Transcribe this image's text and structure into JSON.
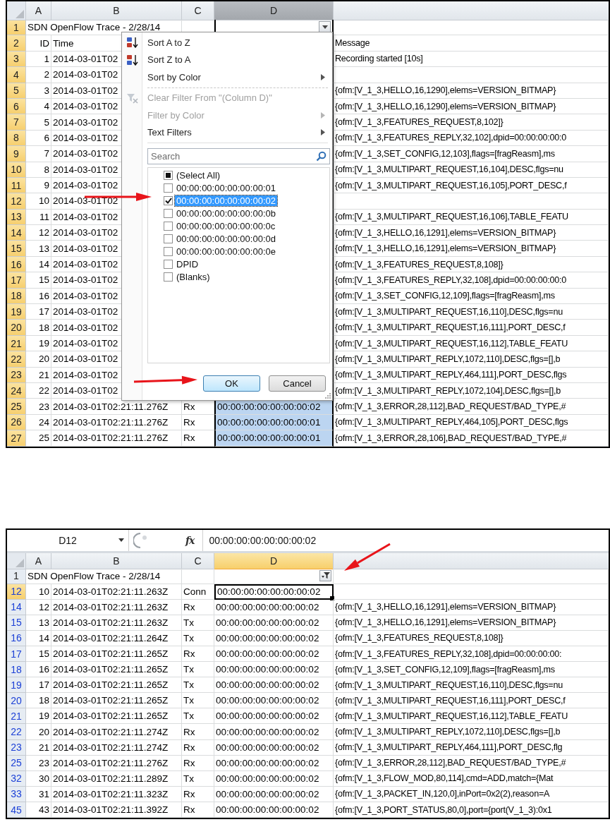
{
  "top_sheet": {
    "columns": [
      {
        "label": "A",
        "selected": false,
        "active": false
      },
      {
        "label": "B",
        "selected": false,
        "active": false
      },
      {
        "label": "C",
        "selected": false,
        "active": false
      },
      {
        "label": "D",
        "selected": true,
        "active": false
      }
    ],
    "rows": [
      {
        "header": "1",
        "active": true,
        "filtered": false,
        "title": "SDN OpenFlow Trace - 2/28/14",
        "filter_applied": false
      },
      {
        "header": "2",
        "active": true,
        "filtered": false,
        "cells": {
          "a": "ID",
          "b": "Time",
          "e": "Message"
        }
      },
      {
        "header": "3",
        "active": true,
        "filtered": false,
        "cells": {
          "a": "1",
          "b": "2014-03-01T02",
          "e": "Recording started [10s]"
        }
      },
      {
        "header": "4",
        "active": true,
        "filtered": false,
        "cells": {
          "a": "2",
          "b": "2014-03-01T02"
        }
      },
      {
        "header": "5",
        "active": true,
        "filtered": false,
        "cells": {
          "a": "3",
          "b": "2014-03-01T02",
          "e": "{ofm:[V_1_3,HELLO,16,1290],elems=VERSION_BITMAP}"
        }
      },
      {
        "header": "6",
        "active": true,
        "filtered": false,
        "cells": {
          "a": "4",
          "b": "2014-03-01T02",
          "e": "{ofm:[V_1_3,HELLO,16,1290],elems=VERSION_BITMAP}"
        }
      },
      {
        "header": "7",
        "active": true,
        "filtered": false,
        "cells": {
          "a": "5",
          "b": "2014-03-01T02",
          "e": "{ofm:[V_1_3,FEATURES_REQUEST,8,102]}"
        }
      },
      {
        "header": "8",
        "active": true,
        "filtered": false,
        "cells": {
          "a": "6",
          "b": "2014-03-01T02",
          "e": "{ofm:[V_1_3,FEATURES_REPLY,32,102],dpid=00:00:00:00:0"
        }
      },
      {
        "header": "9",
        "active": true,
        "filtered": false,
        "cells": {
          "a": "7",
          "b": "2014-03-01T02",
          "e": "{ofm:[V_1_3,SET_CONFIG,12,103],flags=[fragReasm],ms"
        }
      },
      {
        "header": "10",
        "active": true,
        "filtered": false,
        "cells": {
          "a": "8",
          "b": "2014-03-01T02",
          "e": "{ofm:[V_1_3,MULTIPART_REQUEST,16,104],DESC,flgs=nu"
        }
      },
      {
        "header": "11",
        "active": true,
        "filtered": false,
        "cells": {
          "a": "9",
          "b": "2014-03-01T02",
          "e": "{ofm:[V_1_3,MULTIPART_REQUEST,16,105],PORT_DESC,f"
        }
      },
      {
        "header": "12",
        "active": true,
        "filtered": false,
        "cells": {
          "a": "10",
          "b": "2014-03-01T02"
        }
      },
      {
        "header": "13",
        "active": true,
        "filtered": false,
        "cells": {
          "a": "11",
          "b": "2014-03-01T02",
          "e": "{ofm:[V_1_3,MULTIPART_REQUEST,16,106],TABLE_FEATU"
        }
      },
      {
        "header": "14",
        "active": true,
        "filtered": false,
        "cells": {
          "a": "12",
          "b": "2014-03-01T02",
          "e": "{ofm:[V_1_3,HELLO,16,1291],elems=VERSION_BITMAP}"
        }
      },
      {
        "header": "15",
        "active": true,
        "filtered": false,
        "cells": {
          "a": "13",
          "b": "2014-03-01T02",
          "e": "{ofm:[V_1_3,HELLO,16,1291],elems=VERSION_BITMAP}"
        }
      },
      {
        "header": "16",
        "active": true,
        "filtered": false,
        "cells": {
          "a": "14",
          "b": "2014-03-01T02",
          "e": "{ofm:[V_1_3,FEATURES_REQUEST,8,108]}"
        }
      },
      {
        "header": "17",
        "active": true,
        "filtered": false,
        "cells": {
          "a": "15",
          "b": "2014-03-01T02",
          "e": "{ofm:[V_1_3,FEATURES_REPLY,32,108],dpid=00:00:00:00:0"
        }
      },
      {
        "header": "18",
        "active": true,
        "filtered": false,
        "cells": {
          "a": "16",
          "b": "2014-03-01T02",
          "e": "{ofm:[V_1_3,SET_CONFIG,12,109],flags=[fragReasm],ms"
        }
      },
      {
        "header": "19",
        "active": true,
        "filtered": false,
        "cells": {
          "a": "17",
          "b": "2014-03-01T02",
          "e": "{ofm:[V_1_3,MULTIPART_REQUEST,16,110],DESC,flgs=nu"
        }
      },
      {
        "header": "20",
        "active": true,
        "filtered": false,
        "cells": {
          "a": "18",
          "b": "2014-03-01T02",
          "e": "{ofm:[V_1_3,MULTIPART_REQUEST,16,111],PORT_DESC,f"
        }
      },
      {
        "header": "21",
        "active": true,
        "filtered": false,
        "cells": {
          "a": "19",
          "b": "2014-03-01T02",
          "e": "{ofm:[V_1_3,MULTIPART_REQUEST,16,112],TABLE_FEATU"
        }
      },
      {
        "header": "22",
        "active": true,
        "filtered": false,
        "cells": {
          "a": "20",
          "b": "2014-03-01T02",
          "e": "{ofm:[V_1_3,MULTIPART_REPLY,1072,110],DESC,flgs=[],b"
        }
      },
      {
        "header": "23",
        "active": true,
        "filtered": false,
        "cells": {
          "a": "21",
          "b": "2014-03-01T02",
          "e": "{ofm:[V_1_3,MULTIPART_REPLY,464,111],PORT_DESC,flgs"
        }
      },
      {
        "header": "24",
        "active": true,
        "filtered": false,
        "cells": {
          "a": "22",
          "b": "2014-03-01T02",
          "e": "{ofm:[V_1_3,MULTIPART_REPLY,1072,104],DESC,flgs=[],b"
        }
      },
      {
        "header": "25",
        "active": true,
        "filtered": false,
        "d_selected": true,
        "cells": {
          "a": "23",
          "b": "2014-03-01T02:21:11.276Z",
          "c": "Rx",
          "d": "00:00:00:00:00:00:00:02",
          "e": "{ofm:[V_1_3,ERROR,28,112],BAD_REQUEST/BAD_TYPE,#"
        }
      },
      {
        "header": "26",
        "active": true,
        "filtered": false,
        "d_selected": true,
        "cells": {
          "a": "24",
          "b": "2014-03-01T02:21:11.276Z",
          "c": "Rx",
          "d": "00:00:00:00:00:00:00:01",
          "e": "{ofm:[V_1_3,MULTIPART_REPLY,464,105],PORT_DESC,flgs"
        }
      },
      {
        "header": "27",
        "active": true,
        "filtered": false,
        "d_selected": true,
        "cells": {
          "a": "25",
          "b": "2014-03-01T02:21:11.276Z",
          "c": "Rx",
          "d": "00:00:00:00:00:00:00:01",
          "e": "{ofm:[V_1_3,ERROR,28,106],BAD_REQUEST/BAD_TYPE,#"
        }
      }
    ],
    "filter_menu": {
      "items": [
        {
          "label": "Sort A to Z",
          "kind": "sort_ascending",
          "disabled": false,
          "submenu": false
        },
        {
          "label": "Sort Z to A",
          "kind": "sort_descending",
          "disabled": false,
          "submenu": false
        },
        {
          "label": "Sort by Color",
          "kind": "plain",
          "disabled": false,
          "submenu": true
        },
        {
          "kind": "separator"
        },
        {
          "label": "Clear Filter From \"(Column D)\"",
          "kind": "clear_filter",
          "disabled": true,
          "submenu": false
        },
        {
          "label": "Filter by Color",
          "kind": "plain",
          "disabled": true,
          "submenu": true
        },
        {
          "label": "Text Filters",
          "kind": "plain",
          "disabled": false,
          "submenu": true
        }
      ],
      "search": {
        "placeholder": "Search"
      },
      "values": [
        {
          "label": "(Select All)",
          "checked": false,
          "mixed": true,
          "selected": false
        },
        {
          "label": "00:00:00:00:00:00:00:01",
          "checked": false,
          "mixed": false,
          "selected": false
        },
        {
          "label": "00:00:00:00:00:00:00:02",
          "checked": true,
          "mixed": false,
          "selected": true
        },
        {
          "label": "00:00:00:00:00:00:00:0b",
          "checked": false,
          "mixed": false,
          "selected": false
        },
        {
          "label": "00:00:00:00:00:00:00:0c",
          "checked": false,
          "mixed": false,
          "selected": false
        },
        {
          "label": "00:00:00:00:00:00:00:0d",
          "checked": false,
          "mixed": false,
          "selected": false
        },
        {
          "label": "00:00:00:00:00:00:00:0e",
          "checked": false,
          "mixed": false,
          "selected": false
        },
        {
          "label": "DPID",
          "checked": false,
          "mixed": false,
          "selected": false
        },
        {
          "label": "(Blanks)",
          "checked": false,
          "mixed": false,
          "selected": false
        }
      ],
      "buttons": [
        {
          "label": "OK",
          "default": true
        },
        {
          "label": "Cancel",
          "default": false
        }
      ]
    }
  },
  "filtered_sheet": {
    "formula_bar": {
      "name_box": "D12",
      "function_label": "fx",
      "formula": "00:00:00:00:00:00:00:02"
    },
    "columns": [
      {
        "label": "A",
        "selected": false,
        "active": false
      },
      {
        "label": "B",
        "selected": false,
        "active": false
      },
      {
        "label": "C",
        "selected": false,
        "active": false
      },
      {
        "label": "D",
        "selected": false,
        "active": true
      }
    ],
    "rows": [
      {
        "header": "1",
        "active": false,
        "filtered": false,
        "title": "SDN OpenFlow Trace - 2/28/14",
        "filter_applied": true
      },
      {
        "header": "12",
        "active": true,
        "filtered": true,
        "d_active": true,
        "cells": {
          "a": "10",
          "b": "2014-03-01T02:21:11.263Z",
          "c": "Conn",
          "d": "00:00:00:00:00:00:00:02"
        }
      },
      {
        "header": "14",
        "active": false,
        "filtered": true,
        "d_active": false,
        "cells": {
          "a": "12",
          "b": "2014-03-01T02:21:11.263Z",
          "c": "Rx",
          "d": "00:00:00:00:00:00:00:02",
          "e": "{ofm:[V_1_3,HELLO,16,1291],elems=VERSION_BITMAP}"
        }
      },
      {
        "header": "15",
        "active": false,
        "filtered": true,
        "d_active": false,
        "cells": {
          "a": "13",
          "b": "2014-03-01T02:21:11.263Z",
          "c": "Tx",
          "d": "00:00:00:00:00:00:00:02",
          "e": "{ofm:[V_1_3,HELLO,16,1291],elems=VERSION_BITMAP}"
        }
      },
      {
        "header": "16",
        "active": false,
        "filtered": true,
        "d_active": false,
        "cells": {
          "a": "14",
          "b": "2014-03-01T02:21:11.264Z",
          "c": "Tx",
          "d": "00:00:00:00:00:00:00:02",
          "e": "{ofm:[V_1_3,FEATURES_REQUEST,8,108]}"
        }
      },
      {
        "header": "17",
        "active": false,
        "filtered": true,
        "d_active": false,
        "cells": {
          "a": "15",
          "b": "2014-03-01T02:21:11.265Z",
          "c": "Rx",
          "d": "00:00:00:00:00:00:00:02",
          "e": "{ofm:[V_1_3,FEATURES_REPLY,32,108],dpid=00:00:00:00:"
        }
      },
      {
        "header": "18",
        "active": false,
        "filtered": true,
        "d_active": false,
        "cells": {
          "a": "16",
          "b": "2014-03-01T02:21:11.265Z",
          "c": "Tx",
          "d": "00:00:00:00:00:00:00:02",
          "e": "{ofm:[V_1_3,SET_CONFIG,12,109],flags=[fragReasm],ms"
        }
      },
      {
        "header": "19",
        "active": false,
        "filtered": true,
        "d_active": false,
        "cells": {
          "a": "17",
          "b": "2014-03-01T02:21:11.265Z",
          "c": "Tx",
          "d": "00:00:00:00:00:00:00:02",
          "e": "{ofm:[V_1_3,MULTIPART_REQUEST,16,110],DESC,flgs=nu"
        }
      },
      {
        "header": "20",
        "active": false,
        "filtered": true,
        "d_active": false,
        "cells": {
          "a": "18",
          "b": "2014-03-01T02:21:11.265Z",
          "c": "Tx",
          "d": "00:00:00:00:00:00:00:02",
          "e": "{ofm:[V_1_3,MULTIPART_REQUEST,16,111],PORT_DESC,f"
        }
      },
      {
        "header": "21",
        "active": false,
        "filtered": true,
        "d_active": false,
        "cells": {
          "a": "19",
          "b": "2014-03-01T02:21:11.265Z",
          "c": "Tx",
          "d": "00:00:00:00:00:00:00:02",
          "e": "{ofm:[V_1_3,MULTIPART_REQUEST,16,112],TABLE_FEATU"
        }
      },
      {
        "header": "22",
        "active": false,
        "filtered": true,
        "d_active": false,
        "cells": {
          "a": "20",
          "b": "2014-03-01T02:21:11.274Z",
          "c": "Rx",
          "d": "00:00:00:00:00:00:00:02",
          "e": "{ofm:[V_1_3,MULTIPART_REPLY,1072,110],DESC,flgs=[],b"
        }
      },
      {
        "header": "23",
        "active": false,
        "filtered": true,
        "d_active": false,
        "cells": {
          "a": "21",
          "b": "2014-03-01T02:21:11.274Z",
          "c": "Rx",
          "d": "00:00:00:00:00:00:00:02",
          "e": "{ofm:[V_1_3,MULTIPART_REPLY,464,111],PORT_DESC,flg"
        }
      },
      {
        "header": "25",
        "active": false,
        "filtered": true,
        "d_active": false,
        "cells": {
          "a": "23",
          "b": "2014-03-01T02:21:11.276Z",
          "c": "Rx",
          "d": "00:00:00:00:00:00:00:02",
          "e": "{ofm:[V_1_3,ERROR,28,112],BAD_REQUEST/BAD_TYPE,#"
        }
      },
      {
        "header": "32",
        "active": false,
        "filtered": true,
        "d_active": false,
        "cells": {
          "a": "30",
          "b": "2014-03-01T02:21:11.289Z",
          "c": "Tx",
          "d": "00:00:00:00:00:00:00:02",
          "e": "{ofm:[V_1_3,FLOW_MOD,80,114],cmd=ADD,match={Mat"
        }
      },
      {
        "header": "33",
        "active": false,
        "filtered": true,
        "d_active": false,
        "cells": {
          "a": "31",
          "b": "2014-03-01T02:21:11.323Z",
          "c": "Rx",
          "d": "00:00:00:00:00:00:00:02",
          "e": "{ofm:[V_1_3,PACKET_IN,120,0],inPort=0x2(2),reason=A"
        }
      },
      {
        "header": "45",
        "active": false,
        "filtered": true,
        "d_active": false,
        "cells": {
          "a": "43",
          "b": "2014-03-01T02:21:11.392Z",
          "c": "Rx",
          "d": "00:00:00:00:00:00:00:02",
          "e": "{ofm:[V_1_3,PORT_STATUS,80,0],port={port(V_1_3):0x1"
        }
      }
    ]
  }
}
